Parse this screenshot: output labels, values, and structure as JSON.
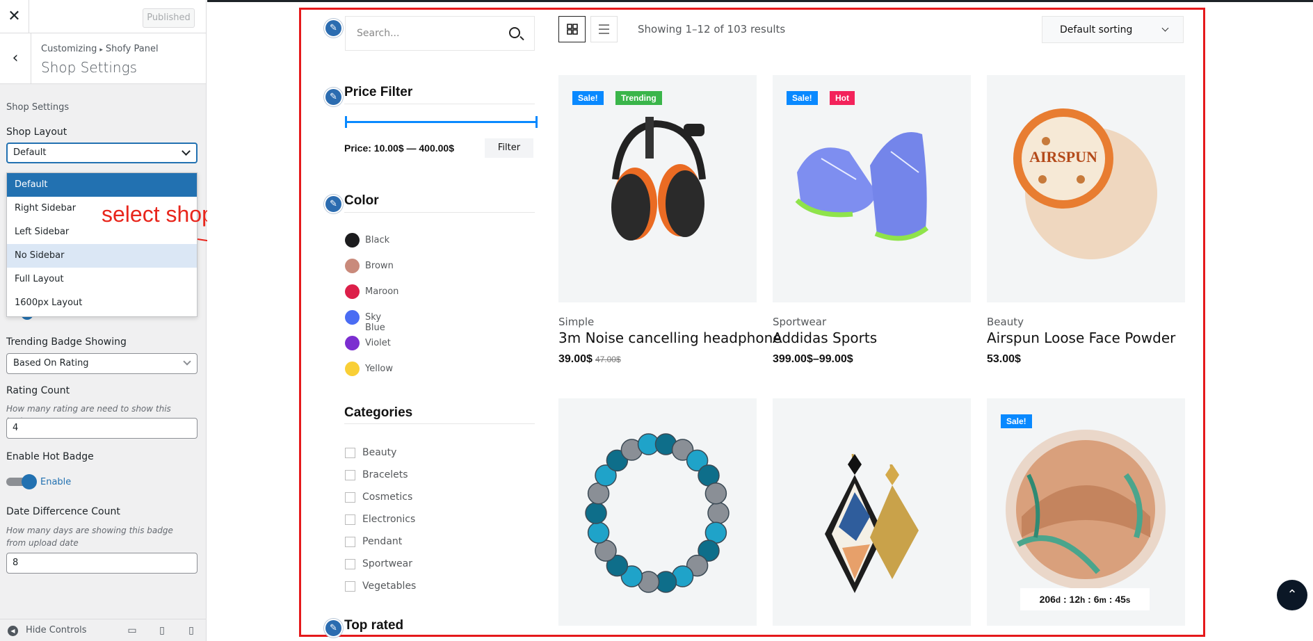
{
  "customizer": {
    "close": "✕",
    "published": "Published",
    "back": "‹",
    "breadcrumb_root": "Customizing",
    "breadcrumb_sep": "▸",
    "breadcrumb_panel": "Shofy Panel",
    "section_title": "Shop Settings",
    "section_label": "Shop Settings",
    "shop_layout_label": "Shop Layout",
    "shop_layout_value": "Default",
    "shop_layout_options": [
      "Default",
      "Right Sidebar",
      "Left Sidebar",
      "No Sidebar",
      "Full Layout",
      "1600px Layout"
    ],
    "trending_label": "Trending Badge Showing",
    "trending_value": "Based On Rating",
    "rating_label": "Rating Count",
    "rating_desc": "How many rating are need to show this badge",
    "rating_value": "4",
    "hot_label": "Enable Hot Badge",
    "hot_toggle_label": "Enable",
    "date_label": "Date Differcence Count",
    "date_desc": "How many days are showing this badge from upload date",
    "date_value": "8",
    "hide_controls": "Hide Controls"
  },
  "annotation": "select shop layout",
  "shop": {
    "search_placeholder": "Search...",
    "price_title": "Price Filter",
    "price_text": "Price: 10.00$ — 400.00$",
    "filter_btn": "Filter",
    "color_title": "Color",
    "colors": [
      {
        "name": "Black",
        "hex": "#1c1c1e"
      },
      {
        "name": "Brown",
        "hex": "#c98a7b"
      },
      {
        "name": "Maroon",
        "hex": "#dc1f49"
      },
      {
        "name": "Sky Blue",
        "hex": "#4a6cf3"
      },
      {
        "name": "Violet",
        "hex": "#7b2ed0"
      },
      {
        "name": "Yellow",
        "hex": "#f9cf36"
      }
    ],
    "categories_title": "Categories",
    "categories": [
      "Beauty",
      "Bracelets",
      "Cosmetics",
      "Electronics",
      "Pendant",
      "Sportwear",
      "Vegetables"
    ],
    "top_rated_title": "Top rated",
    "showing": "Showing 1–12 of 103 results",
    "sorting": "Default sorting",
    "products": [
      {
        "category": "Simple",
        "title": "3m Noise cancelling headphone",
        "price": "39.00$",
        "old_price": "47.00$",
        "badges": [
          "Sale!",
          "Trending"
        ]
      },
      {
        "category": "Sportwear",
        "title": "Addidas Sports",
        "price": "399.00$–99.00$",
        "old_price": "",
        "badges": [
          "Sale!",
          "Hot"
        ]
      },
      {
        "category": "Beauty",
        "title": "Airspun Loose Face Powder",
        "price": "53.00$",
        "old_price": "",
        "badges": []
      },
      {
        "category": "",
        "title": "",
        "price": "",
        "old_price": "",
        "badges": []
      },
      {
        "category": "",
        "title": "",
        "price": "",
        "old_price": "",
        "badges": []
      },
      {
        "category": "",
        "title": "",
        "price": "",
        "old_price": "",
        "badges": [
          "Sale!"
        ]
      }
    ],
    "countdown": {
      "days": "206",
      "hours": "12",
      "minutes": "6",
      "seconds": "45"
    },
    "badge_colors": {
      "Sale!": "#0989ff",
      "Trending": "#3ab54a",
      "Hot": "#f3235b"
    }
  }
}
